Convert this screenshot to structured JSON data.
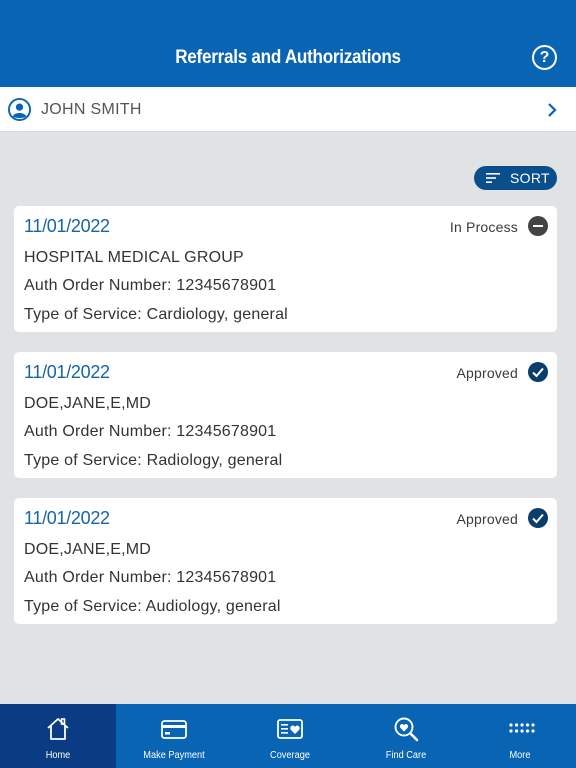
{
  "header": {
    "title": "Referrals and Authorizations",
    "help_glyph": "?"
  },
  "member": {
    "name": "JOHN SMITH"
  },
  "sort": {
    "label": "SORT"
  },
  "cards": [
    {
      "date": "11/01/2022",
      "status": "In Process",
      "status_type": "in-process",
      "provider": "HOSPITAL MEDICAL GROUP",
      "auth": "Auth Order Number: 12345678901",
      "service": "Type of Service: Cardiology, general"
    },
    {
      "date": "11/01/2022",
      "status": "Approved",
      "status_type": "approved",
      "provider": "DOE,JANE,E,MD",
      "auth": "Auth Order Number: 12345678901",
      "service": "Type of Service: Radiology, general"
    },
    {
      "date": "11/01/2022",
      "status": "Approved",
      "status_type": "approved",
      "provider": "DOE,JANE,E,MD",
      "auth": "Auth Order Number: 12345678901",
      "service": "Type of Service: Audiology, general"
    }
  ],
  "tabs": [
    {
      "label": "Home",
      "icon": "home-icon",
      "active": true
    },
    {
      "label": "Make Payment",
      "icon": "credit-card-icon",
      "active": false
    },
    {
      "label": "Coverage",
      "icon": "coverage-card-icon",
      "active": false
    },
    {
      "label": "Find Care",
      "icon": "search-heart-icon",
      "active": false
    },
    {
      "label": "More",
      "icon": "more-dots-icon",
      "active": false
    }
  ],
  "colors": {
    "header": "#0a64b4",
    "tab_active": "#0b3b82",
    "sort_button": "#0a4f8c",
    "date_text": "#1565a8",
    "approved_icon": "#0a3d6b",
    "in_process_icon": "#444444"
  }
}
